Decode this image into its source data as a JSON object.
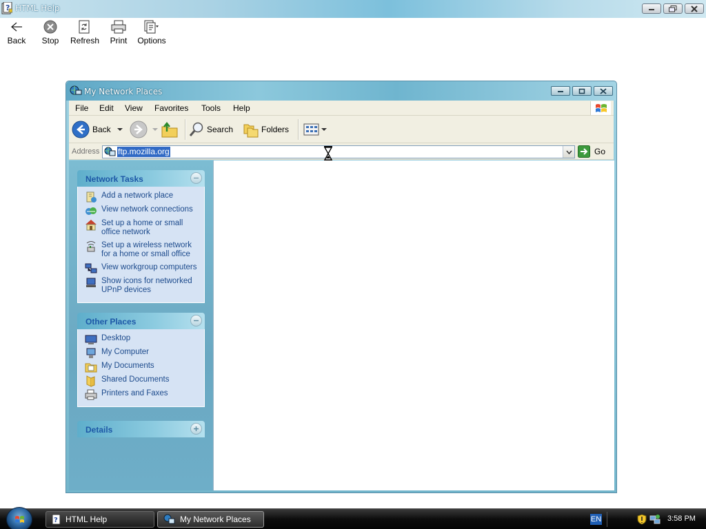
{
  "help_window": {
    "title": "HTML Help",
    "toolbar": [
      {
        "label": "Back",
        "icon": "back-arrow-icon"
      },
      {
        "label": "Stop",
        "icon": "stop-icon"
      },
      {
        "label": "Refresh",
        "icon": "refresh-icon"
      },
      {
        "label": "Print",
        "icon": "printer-icon"
      },
      {
        "label": "Options",
        "icon": "options-icon"
      }
    ]
  },
  "explorer": {
    "title": "My Network Places",
    "menu": [
      "File",
      "Edit",
      "View",
      "Favorites",
      "Tools",
      "Help"
    ],
    "toolbar": {
      "back_label": "Back",
      "search_label": "Search",
      "folders_label": "Folders"
    },
    "address": {
      "label": "Address",
      "value": "ftp.mozilla.org",
      "go_label": "Go"
    },
    "task_pane": {
      "network_tasks": {
        "title": "Network Tasks",
        "items": [
          {
            "label": "Add a network place",
            "icon": "add-network-place-icon"
          },
          {
            "label": "View network connections",
            "icon": "network-connections-icon"
          },
          {
            "label": "Set up a home or small office network",
            "icon": "home-network-icon"
          },
          {
            "label": "Set up a wireless network for a home or small office",
            "icon": "wireless-network-icon"
          },
          {
            "label": "View workgroup computers",
            "icon": "workgroup-computers-icon"
          },
          {
            "label": "Show icons for networked UPnP devices",
            "icon": "upnp-devices-icon"
          }
        ]
      },
      "other_places": {
        "title": "Other Places",
        "items": [
          {
            "label": "Desktop",
            "icon": "desktop-icon"
          },
          {
            "label": "My Computer",
            "icon": "my-computer-icon"
          },
          {
            "label": "My Documents",
            "icon": "my-documents-icon"
          },
          {
            "label": "Shared Documents",
            "icon": "shared-documents-icon"
          },
          {
            "label": "Printers and Faxes",
            "icon": "printers-faxes-icon"
          }
        ]
      },
      "details": {
        "title": "Details"
      }
    }
  },
  "taskbar": {
    "buttons": [
      {
        "label": "HTML Help"
      },
      {
        "label": "My Network Places"
      }
    ],
    "language": "EN",
    "clock": "3:58 PM"
  }
}
